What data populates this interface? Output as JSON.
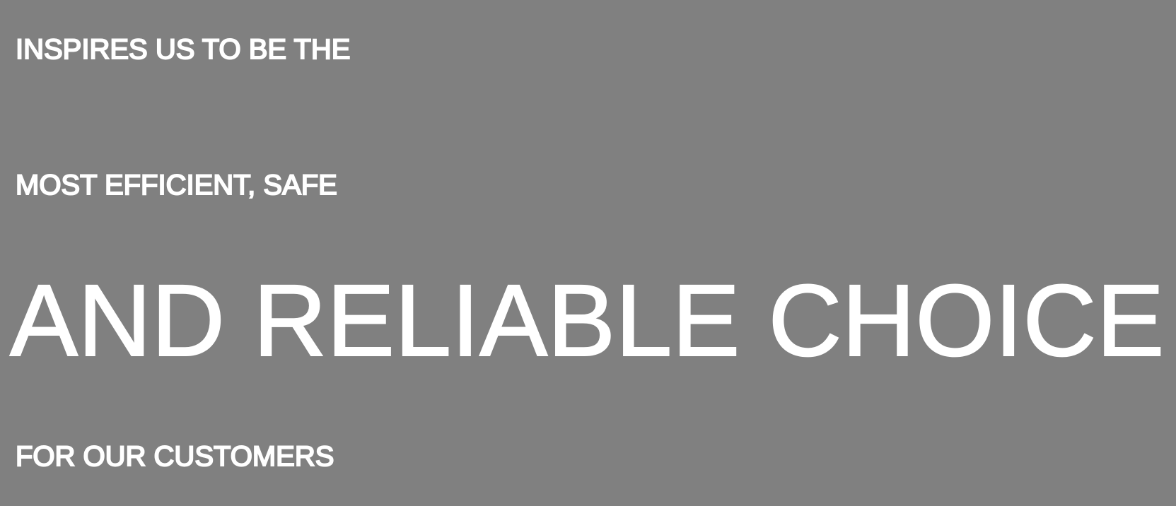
{
  "headline": {
    "lines": [
      "INSPIRES US TO BE THE",
      "MOST EFFICIENT, SAFE",
      "AND RELIABLE CHOICE",
      "FOR OUR CUSTOMERS"
    ]
  },
  "colors": {
    "background": "#808080",
    "text": "#ffffff"
  }
}
